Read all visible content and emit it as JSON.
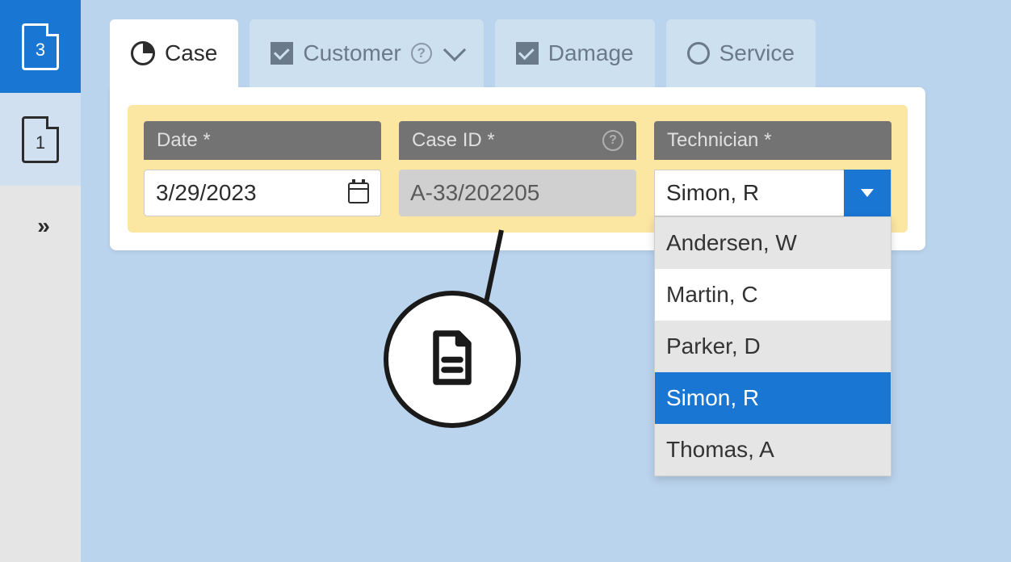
{
  "sidebar": {
    "items": [
      {
        "badge": "3"
      },
      {
        "badge": "1"
      }
    ]
  },
  "tabs": [
    {
      "label": "Case",
      "icon": "pie"
    },
    {
      "label": "Customer",
      "icon": "check",
      "help": true,
      "dropdown": true
    },
    {
      "label": "Damage",
      "icon": "check"
    },
    {
      "label": "Service",
      "icon": "circle"
    }
  ],
  "form": {
    "date": {
      "label": "Date *",
      "value": "3/29/2023"
    },
    "case_id": {
      "label": "Case ID *",
      "value": "A-33/202205"
    },
    "technician": {
      "label": "Technician *",
      "value": "Simon, R",
      "options": [
        "Andersen, W",
        "Martin, C",
        "Parker, D",
        "Simon, R",
        "Thomas, A"
      ]
    }
  }
}
